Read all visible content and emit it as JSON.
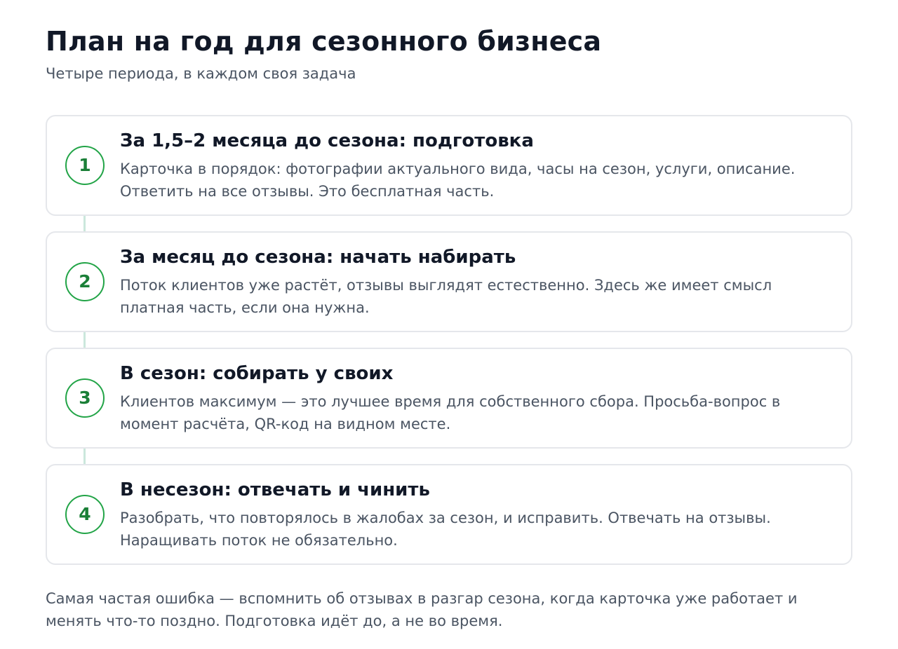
{
  "header": {
    "title": "План на год для сезонного бизнеса",
    "subtitle": "Четыре периода, в каждом своя задача"
  },
  "steps": [
    {
      "number": "1",
      "title": "За 1,5–2 месяца до сезона: подготовка",
      "text": "Карточка в порядок: фотографии актуального вида, часы на сезон, услуги, описание. Ответить на все отзывы. Это бесплатная часть."
    },
    {
      "number": "2",
      "title": "За месяц до сезона: начать набирать",
      "text": "Поток клиентов уже растёт, отзывы выглядят естественно. Здесь же имеет смысл платная часть, если она нужна."
    },
    {
      "number": "3",
      "title": "В сезон: собирать у своих",
      "text": "Клиентов максимум — это лучшее время для собственного сбора. Просьба-вопрос в момент расчёта, QR-код на видном месте."
    },
    {
      "number": "4",
      "title": "В несезон: отвечать и чинить",
      "text": "Разобрать, что повторялось в жалобах за сезон, и исправить. Отвечать на отзывы. Наращивать поток не обязательно."
    }
  ],
  "note": "Самая частая ошибка — вспомнить об отзывах в разгар сезона, когда карточка уже работает и менять что-то поздно. Подготовка идёт до, а не во время.",
  "colors": {
    "accent": "#1a7f37",
    "accent_border": "#22a447",
    "connector": "#cbe7dc",
    "card_border": "#e5e7eb",
    "heading": "#111827",
    "body_text": "#4b5563"
  }
}
